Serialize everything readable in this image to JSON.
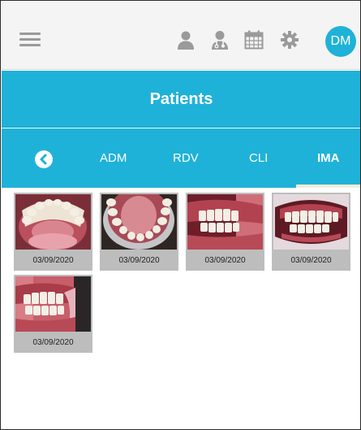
{
  "header": {
    "user_initials": "DM",
    "icons": [
      "menu-icon",
      "user-icon",
      "doctor-icon",
      "calendar-icon",
      "gear-icon"
    ]
  },
  "page": {
    "title": "Patients"
  },
  "tabs": {
    "back_icon": "chevron-left-circle-icon",
    "items": [
      {
        "label": "ADM",
        "active": false
      },
      {
        "label": "RDV",
        "active": false
      },
      {
        "label": "CLI",
        "active": false
      },
      {
        "label": "IMA",
        "active": true
      }
    ]
  },
  "gallery": {
    "items": [
      {
        "date": "03/09/2020",
        "view": "lower-arch"
      },
      {
        "date": "03/09/2020",
        "view": "upper-arch"
      },
      {
        "date": "03/09/2020",
        "view": "right-side"
      },
      {
        "date": "03/09/2020",
        "view": "front"
      },
      {
        "date": "03/09/2020",
        "view": "left-side"
      }
    ]
  },
  "colors": {
    "accent": "#1fb2d8",
    "header_bg": "#f4f4f4",
    "icon_gray": "#9a9a9a",
    "tab_indicator": "#f3edd9",
    "thumb_bg": "#bdbdbd"
  }
}
